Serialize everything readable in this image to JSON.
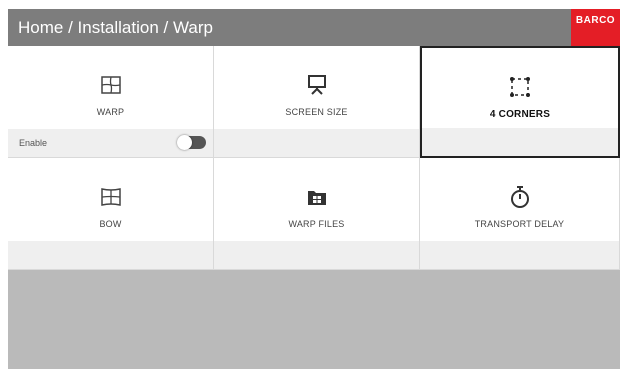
{
  "header": {
    "breadcrumb": "Home / Installation / Warp",
    "logo": "BARCO"
  },
  "tiles": [
    {
      "label": "WARP",
      "icon": "warp-icon",
      "enable_label": "Enable",
      "enabled": false
    },
    {
      "label": "SCREEN SIZE",
      "icon": "screen-size-icon"
    },
    {
      "label": "4 CORNERS",
      "icon": "four-corners-icon",
      "selected": true
    },
    {
      "label": "BOW",
      "icon": "bow-icon"
    },
    {
      "label": "WARP FILES",
      "icon": "warp-files-icon"
    },
    {
      "label": "TRANSPORT DELAY",
      "icon": "stopwatch-icon"
    }
  ],
  "colors": {
    "header_bg": "#7d7d7d",
    "logo_bg": "#e41e26",
    "tile_bottom_bg": "#efefef",
    "footer_bg": "#bababa"
  }
}
